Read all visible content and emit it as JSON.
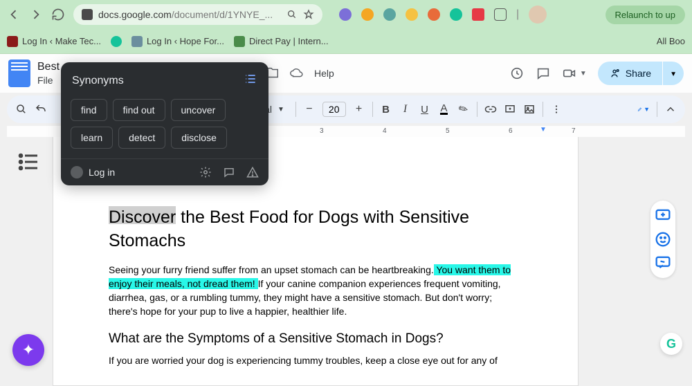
{
  "browser": {
    "url_host": "docs.google.com",
    "url_path": "/document/d/1YNYE_...",
    "relaunch_label": "Relaunch to up",
    "bookmarks": [
      {
        "label": "Log In ‹ Make Tec..."
      },
      {
        "label": ""
      },
      {
        "label": "Log In ‹ Hope For..."
      },
      {
        "label": "Direct Pay | Intern..."
      }
    ],
    "bookmark_right": "All Boo"
  },
  "docs": {
    "title": "Best",
    "menus": [
      "File"
    ],
    "menu_help": "Help",
    "share_label": "Share",
    "font_name": "Arial",
    "font_size": "20",
    "ruler_marks": [
      "3",
      "4",
      "5",
      "6",
      "7"
    ]
  },
  "synonyms": {
    "title": "Synonyms",
    "chips": [
      "find",
      "find out",
      "uncover",
      "learn",
      "detect",
      "disclose"
    ],
    "login_label": "Log in"
  },
  "document": {
    "h1": "Discover the Best Food for Dogs with Sensitive Stomachs",
    "p1_a": "Seeing your furry friend suffer from an upset stomach can be heartbreaking.",
    "p1_hl": " You want them to enjoy their meals, not dread them! ",
    "p1_b": "If your canine companion experiences frequent vomiting, diarrhea, gas, or a rumbling tummy, they might have a sensitive stomach. But don't worry; there's hope for your pup to live a happier, healthier life.",
    "h2": "What are the Symptoms of a Sensitive Stomach in Dogs?",
    "p2": "If you are worried your dog is experiencing tummy troubles, keep a close eye out for any of"
  }
}
